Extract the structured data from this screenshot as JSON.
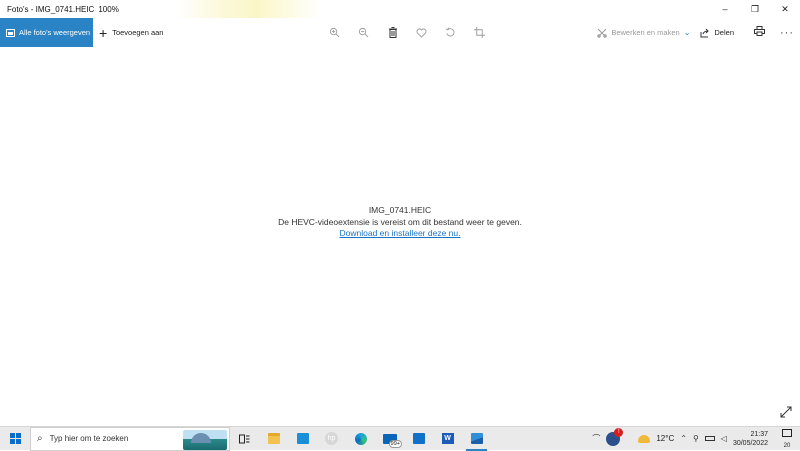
{
  "window": {
    "app_title": "Foto's - IMG_0741.HEIC",
    "zoom": "100%",
    "controls": {
      "minimize": "–",
      "maximize": "❐",
      "close": "✕"
    }
  },
  "toolbar": {
    "all_photos_label": "Alle foto's weergeven",
    "add_label": "Toevoegen aan",
    "edit_label": "Bewerken en maken",
    "share_label": "Delen",
    "icons": [
      "zoom-in-icon",
      "zoom-out-icon",
      "trash-icon",
      "heart-icon",
      "rotate-icon",
      "crop-icon"
    ]
  },
  "content": {
    "filename": "IMG_0741.HEIC",
    "message": "De HEVC-videoextensie is vereist om dit bestand weer te geven.",
    "link_text": "Download en installeer deze nu."
  },
  "taskbar": {
    "search_placeholder": "Typ hier om te zoeken",
    "mail_badge": "99+",
    "temperature": "12°C",
    "time": "21:37",
    "date": "30/05/2022",
    "notification_count": "20"
  },
  "colors": {
    "accent": "#2a83c5",
    "link": "#1a73c7",
    "taskbar_bg": "#eaeaea"
  }
}
